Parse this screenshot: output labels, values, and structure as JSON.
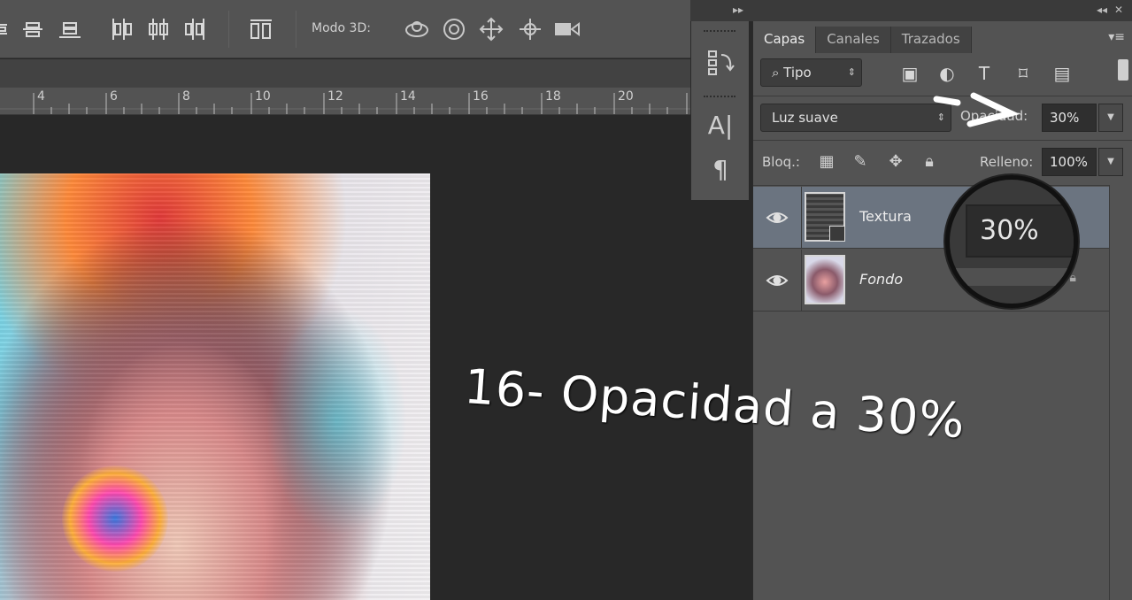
{
  "options_bar": {
    "mode_3d_label": "Modo 3D:"
  },
  "ruler": {
    "ticks": [
      "4",
      "6",
      "8",
      "10",
      "12",
      "14",
      "16",
      "18",
      "20"
    ]
  },
  "layers_panel": {
    "tabs": [
      {
        "label": "Capas",
        "active": true
      },
      {
        "label": "Canales",
        "active": false
      },
      {
        "label": "Trazados",
        "active": false
      }
    ],
    "filter_kind": "Tipo",
    "blend_mode": "Luz suave",
    "opacity_label": "Opacidad:",
    "opacity_value": "30%",
    "lock_label": "Bloq.:",
    "fill_label": "Relleno:",
    "fill_value": "100%",
    "layers": [
      {
        "name": "Textura",
        "selected": true,
        "visible": true
      },
      {
        "name": "Fondo",
        "selected": false,
        "visible": true,
        "locked": true
      }
    ]
  },
  "zoom_callout": {
    "value": "30%"
  },
  "caption": "16- Opacidad a 30%",
  "colors": {
    "panel_bg": "#535353",
    "canvas_bg": "#282828",
    "selected_layer": "#6b7480"
  }
}
